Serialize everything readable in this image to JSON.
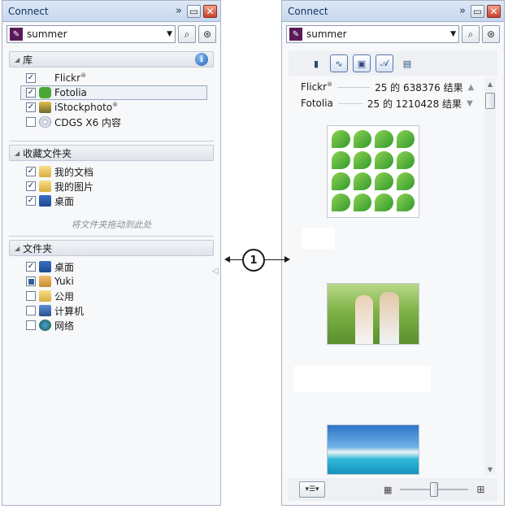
{
  "left_panel": {
    "title": "Connect",
    "search_value": "summer",
    "library": {
      "header": "库",
      "items": [
        {
          "label": "Flickr",
          "mark": "®",
          "checked": true
        },
        {
          "label": "Fotolia",
          "checked": true
        },
        {
          "label": "iStockphoto",
          "mark": "®",
          "checked": true
        },
        {
          "label": "CDGS X6 内容",
          "checked": false
        }
      ]
    },
    "favorites": {
      "header": "收藏文件夹",
      "items": [
        {
          "label": "我的文档",
          "checked": true
        },
        {
          "label": "我的图片",
          "checked": true
        },
        {
          "label": "桌面",
          "checked": true
        }
      ],
      "drop_hint": "将文件夹拖动到此处"
    },
    "folders": {
      "header": "文件夹",
      "items": [
        {
          "label": "桌面",
          "checked": true
        },
        {
          "label": "Yuki",
          "checked": "partial"
        },
        {
          "label": "公用",
          "checked": false
        },
        {
          "label": "计算机",
          "checked": false
        },
        {
          "label": "网络",
          "checked": false
        }
      ]
    }
  },
  "right_panel": {
    "title": "Connect",
    "search_value": "summer",
    "results": [
      {
        "source": "Flickr",
        "mark": "®",
        "text": "25 的 638376 结果"
      },
      {
        "source": "Fotolia",
        "text": "25 的 1210428 结果"
      }
    ]
  },
  "callout": {
    "number": "1"
  },
  "icons": {
    "chevron": "»",
    "minimize": "▭",
    "close": "✕",
    "search": "⌕",
    "info": "i"
  }
}
